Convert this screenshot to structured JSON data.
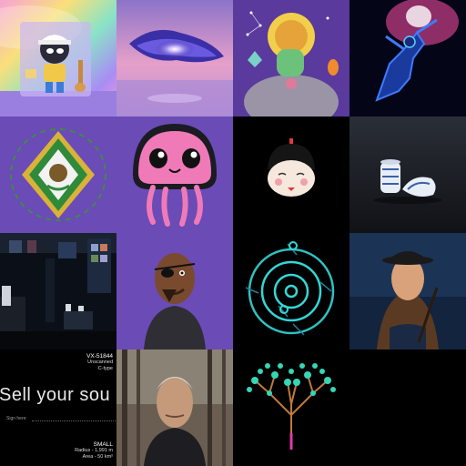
{
  "grid": {
    "tiles": [
      {
        "name": "toy-figure-rainbow"
      },
      {
        "name": "galaxy-swirl-sunset"
      },
      {
        "name": "sunflower-head-character"
      },
      {
        "name": "neon-dancer"
      },
      {
        "name": "green-diamond-emblem"
      },
      {
        "name": "pink-jellyfish"
      },
      {
        "name": "doll-face-icon"
      },
      {
        "name": "porcelain-vases"
      },
      {
        "name": "dark-gallery-room"
      },
      {
        "name": "eyepatch-character"
      },
      {
        "name": "blue-ring-orbit"
      },
      {
        "name": "bowler-hat-woman"
      },
      {
        "name": "sell-your-soul-card"
      },
      {
        "name": "man-in-forest"
      },
      {
        "name": "neon-tree"
      }
    ]
  },
  "sell_card": {
    "headline": "Sell your sou",
    "sign_label": "Sign here:",
    "code": "VX-51844",
    "status": "Unscanned",
    "type": "C-type",
    "size": "SMALL",
    "radius": "Radius - 1,991 m",
    "area": "Area - 50 km²"
  },
  "colors": {
    "purple_bg": "#6b4bb5",
    "neon_cyan": "#35d6d6",
    "jelly_pink": "#f07ab8"
  }
}
